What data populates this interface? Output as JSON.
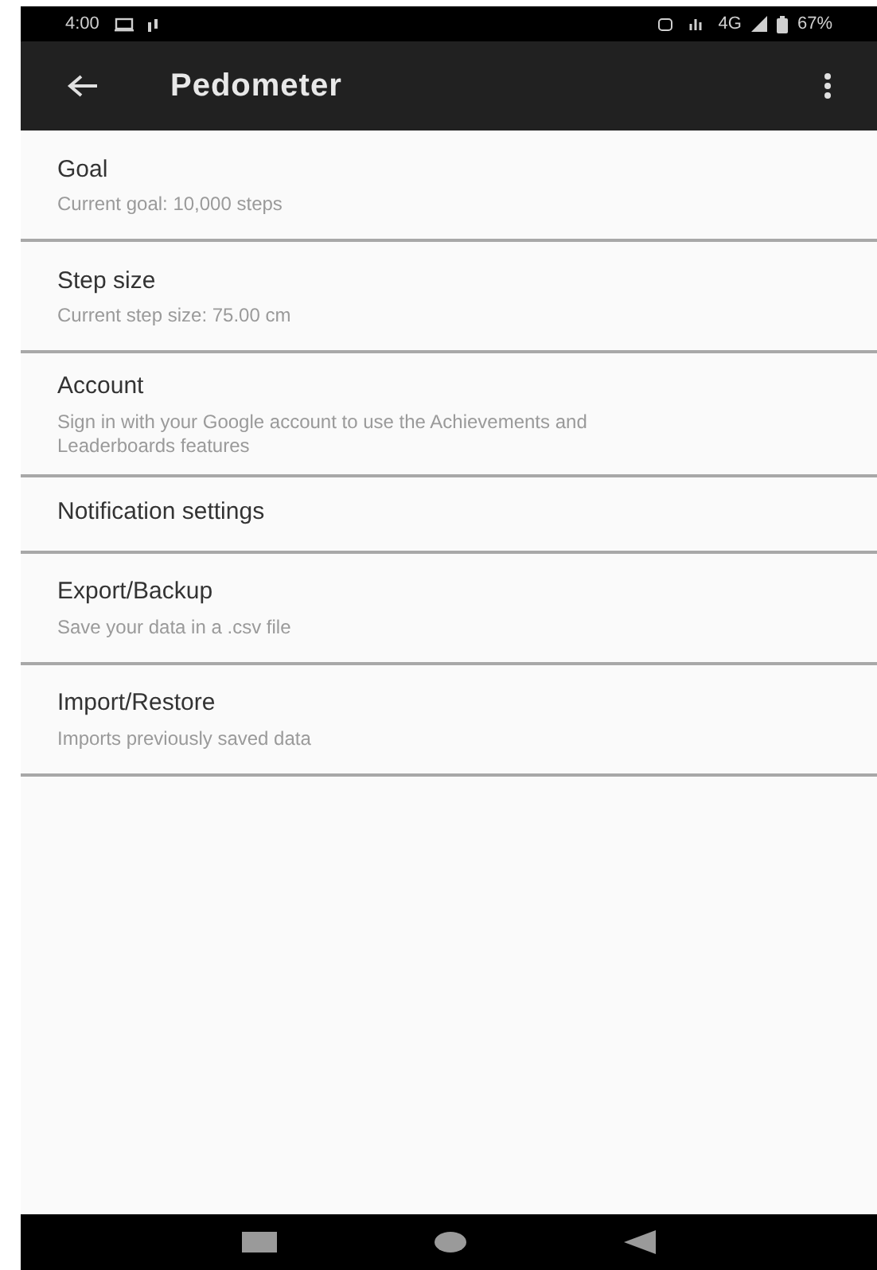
{
  "status_bar": {
    "time": "4:00",
    "network": "4G",
    "battery": "67%"
  },
  "app_bar": {
    "title": "Pedometer"
  },
  "settings": [
    {
      "title": "Goal",
      "summary": "Current goal: 10,000 steps"
    },
    {
      "title": "Step size",
      "summary": "Current step size: 75.00 cm"
    },
    {
      "title": "Account",
      "summary": "Sign in with your Google account to use the Achievements and Leaderboards features"
    },
    {
      "title": "Notification settings"
    },
    {
      "title": "Export/Backup",
      "summary": "Save your data in a .csv file"
    },
    {
      "title": "Import/Restore",
      "summary": "Imports previously saved data"
    }
  ]
}
